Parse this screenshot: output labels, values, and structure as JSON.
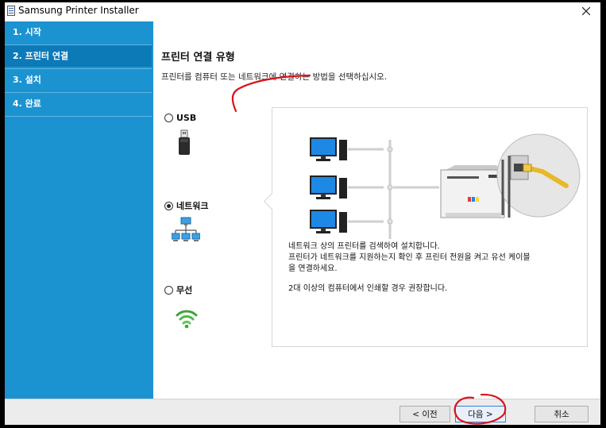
{
  "window": {
    "title": "Samsung Printer Installer"
  },
  "sidebar": {
    "steps": [
      {
        "label": "1. 시작"
      },
      {
        "label": "2. 프린터 연결"
      },
      {
        "label": "3. 설치"
      },
      {
        "label": "4. 완료"
      }
    ]
  },
  "main": {
    "heading": "프린터 연결 유형",
    "subtitle": "프린터를 컴퓨터 또는 네트워크에 연결하는 방법을 선택하십시오.",
    "options": [
      {
        "label": "USB",
        "icon": "usb-drive-icon",
        "selected": false
      },
      {
        "label": "네트워크",
        "icon": "network-icon",
        "selected": true
      },
      {
        "label": "무선",
        "icon": "wifi-icon",
        "selected": false
      }
    ],
    "description": {
      "line1": "네트워크 상의 프린터를 검색하여 설치합니다.",
      "line2": "프린터가 네트워크를 지원하는지 확인 후 프린터 전원을 켜고 유선 케이블",
      "line3": "을 연결하세요.",
      "line4": "2대 이상의 컴퓨터에서 인쇄할 경우 권장합니다."
    }
  },
  "footer": {
    "back_label": "< 이전",
    "next_label": "다음 >",
    "cancel_label": "취소"
  },
  "colors": {
    "sidebar": "#1b93d1",
    "sidebar_active": "#0d7ab8",
    "annotation": "#d9141b"
  }
}
